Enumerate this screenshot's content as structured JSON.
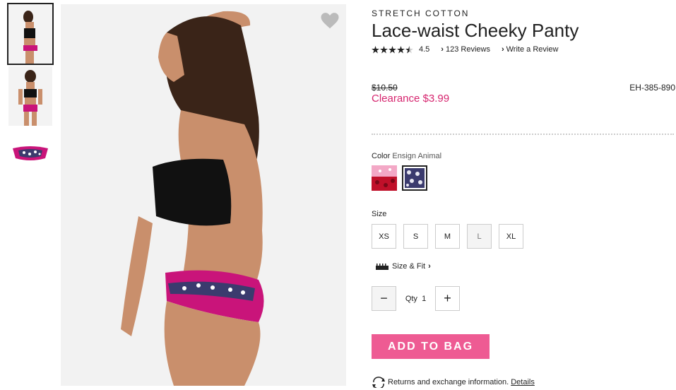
{
  "product": {
    "brand": "STRETCH COTTON",
    "title": "Lace-waist Cheeky Panty",
    "rating": "4.5",
    "rating_stars": 4.5,
    "reviews_link": "123 Reviews",
    "write_review_link": "Write a Review",
    "original_price": "$10.50",
    "sale_price": "Clearance $3.99",
    "sku": "EH-385-890"
  },
  "color": {
    "label": "Color",
    "selected": "Ensign Animal"
  },
  "size": {
    "label": "Size",
    "options": [
      "XS",
      "S",
      "M",
      "L",
      "XL"
    ]
  },
  "size_fit_link": "Size & Fit",
  "quantity": {
    "label": "Qty",
    "value": "1",
    "minus": "−",
    "plus": "+"
  },
  "add_to_bag": "ADD TO BAG",
  "returns": {
    "text": "Returns and exchange information.",
    "details_link": "Details"
  },
  "colors": {
    "accent": "#ee5b93",
    "clearance": "#d6246e",
    "lace_pink": "#c9147a",
    "hair": "#3a2418",
    "skin": "#c98f6c"
  },
  "icons": [
    "heart-icon",
    "star-icon",
    "chevron-right-icon",
    "ruler-icon",
    "returns-icon"
  ]
}
